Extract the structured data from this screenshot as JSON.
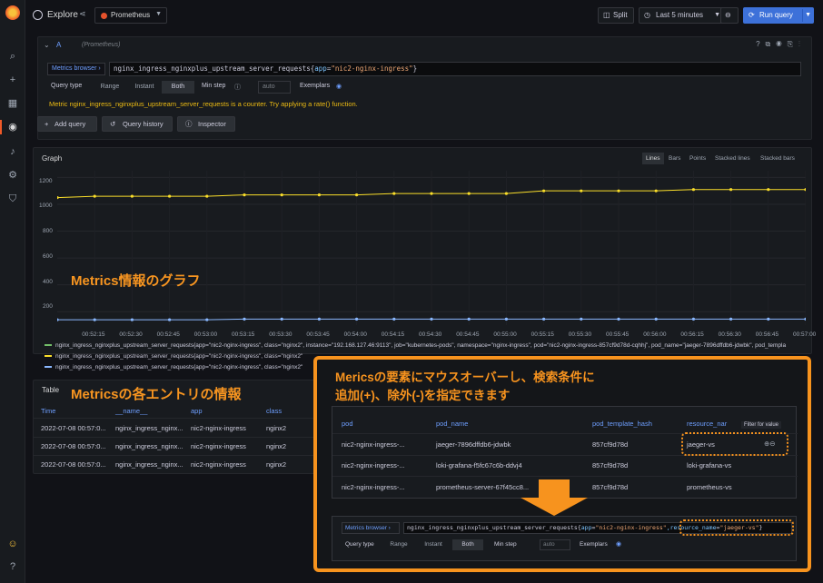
{
  "app": {
    "title": "Explore",
    "datasource": "Prometheus"
  },
  "toolbar": {
    "split": "Split",
    "time": "Last 5 minutes",
    "run": "Run query"
  },
  "query": {
    "letter": "A",
    "ds": "(Prometheus)",
    "metrics_browser": "Metrics browser",
    "expr_metric": "nginx_ingress_nginxplus_upstream_server_requests",
    "expr_open": "{",
    "expr_key": "app",
    "expr_eq": "=",
    "expr_val": "\"nic2-nginx-ingress\"",
    "expr_close": "}",
    "query_type_label": "Query type",
    "types": [
      "Range",
      "Instant",
      "Both"
    ],
    "min_step": "Min step",
    "min_step_placeholder": "auto",
    "exemplars": "Exemplars",
    "warning": "Metric nginx_ingress_nginxplus_upstream_server_requests is a counter. Try applying a rate() function."
  },
  "actions": {
    "add": "Add query",
    "history": "Query history",
    "inspector": "Inspector"
  },
  "graph": {
    "title": "Graph",
    "views": [
      "Lines",
      "Bars",
      "Points",
      "Stacked lines",
      "Stacked bars"
    ],
    "yticks": [
      "1200",
      "1000",
      "800",
      "600",
      "400",
      "200"
    ],
    "xticks": [
      "00:52:15",
      "00:52:30",
      "00:52:45",
      "00:53:00",
      "00:53:15",
      "00:53:30",
      "00:53:45",
      "00:54:00",
      "00:54:15",
      "00:54:30",
      "00:54:45",
      "00:55:00",
      "00:55:15",
      "00:55:30",
      "00:55:45",
      "00:56:00",
      "00:56:15",
      "00:56:30",
      "00:56:45",
      "00:57:00"
    ],
    "legend": [
      "nginx_ingress_nginxplus_upstream_server_requests{app=\"nic2-nginx-ingress\", class=\"nginx2\", instance=\"192.168.127.46:9113\", job=\"kubernetes-pods\", namespace=\"nginx-ingress\", pod=\"nic2-nginx-ingress-857cf9d78d-cqhhj\", pod_name=\"jaeger-7896dffdb6-jdwbk\", pod_templa",
      "nginx_ingress_nginxplus_upstream_server_requests{app=\"nic2-nginx-ingress\", class=\"nginx2\"",
      "nginx_ingress_nginxplus_upstream_server_requests{app=\"nic2-nginx-ingress\", class=\"nginx2\""
    ],
    "colors": {
      "green": "#73bf69",
      "yellow": "#fade2a",
      "blue": "#8ab8ff"
    }
  },
  "chart_data": {
    "type": "line",
    "x": [
      "00:52:00",
      "00:52:15",
      "00:52:30",
      "00:52:45",
      "00:53:00",
      "00:53:15",
      "00:53:30",
      "00:53:45",
      "00:54:00",
      "00:54:15",
      "00:54:30",
      "00:54:45",
      "00:55:00",
      "00:55:15",
      "00:55:30",
      "00:55:45",
      "00:56:00",
      "00:56:15",
      "00:56:30",
      "00:56:45",
      "00:57:00"
    ],
    "ylim": [
      100,
      1250
    ],
    "series": [
      {
        "color": "#fade2a",
        "values": [
          1050,
          1060,
          1060,
          1060,
          1060,
          1070,
          1070,
          1070,
          1070,
          1080,
          1080,
          1080,
          1080,
          1100,
          1100,
          1100,
          1100,
          1110,
          1110,
          1110,
          1110
        ]
      },
      {
        "color": "#8ab8ff",
        "values": [
          140,
          140,
          140,
          140,
          140,
          145,
          145,
          145,
          145,
          145,
          145,
          145,
          145,
          145,
          145,
          145,
          145,
          145,
          145,
          145,
          145
        ]
      }
    ]
  },
  "annotations": {
    "graph_note": "Metrics情報のグラフ",
    "table_note": "Metricsの各エントリの情報",
    "callout_line1": "Mericsの要素にマウスオーバーし、検索条件に",
    "callout_line2": "追加(+)、除外(-)を指定できます"
  },
  "table": {
    "title": "Table",
    "headers": [
      "Time",
      "__name__",
      "app",
      "class"
    ],
    "rows": [
      [
        "2022-07-08 00:57:0...",
        "nginx_ingress_nginx...",
        "nic2-nginx-ingress",
        "nginx2"
      ],
      [
        "2022-07-08 00:57:0...",
        "nginx_ingress_nginx...",
        "nic2-nginx-ingress",
        "nginx2"
      ],
      [
        "2022-07-08 00:57:0...",
        "nginx_ingress_nginx...",
        "nic2-nginx-ingress",
        "nginx2"
      ]
    ]
  },
  "inset_table": {
    "headers": [
      "pod",
      "pod_name",
      "pod_template_hash",
      "resource_nar"
    ],
    "filter_tip": "Filter for value",
    "rows": [
      [
        "nic2-nginx-ingress-...",
        "jaeger-7896dffdb6-jdwbk",
        "857cf9d78d",
        "jaeger-vs"
      ],
      [
        "nic2-nginx-ingress-...",
        "loki-grafana-f5fc67c6b-ddvj4",
        "857cf9d78d",
        "loki-grafana-vs"
      ],
      [
        "nic2-nginx-ingress-...",
        "prometheus-server-67f45cc8...",
        "857cf9d78d",
        "prometheus-vs"
      ]
    ]
  },
  "inset_query": {
    "metrics_browser": "Metrics browser",
    "expr_metric": "nginx_ingress_nginxplus_upstream_server_requests",
    "expr_open": "{",
    "expr_key": "app",
    "expr_eq": "=",
    "expr_val": "\"nic2-nginx-ingress\"",
    "expr_add_key": ",resource_name",
    "expr_add_eq": "=",
    "expr_add_val": "\"jaeger-vs\"",
    "expr_close": "}",
    "query_type_label": "Query type",
    "types": [
      "Range",
      "Instant",
      "Both"
    ],
    "min_step": "Min step",
    "min_step_placeholder": "auto",
    "exemplars": "Exemplars"
  }
}
